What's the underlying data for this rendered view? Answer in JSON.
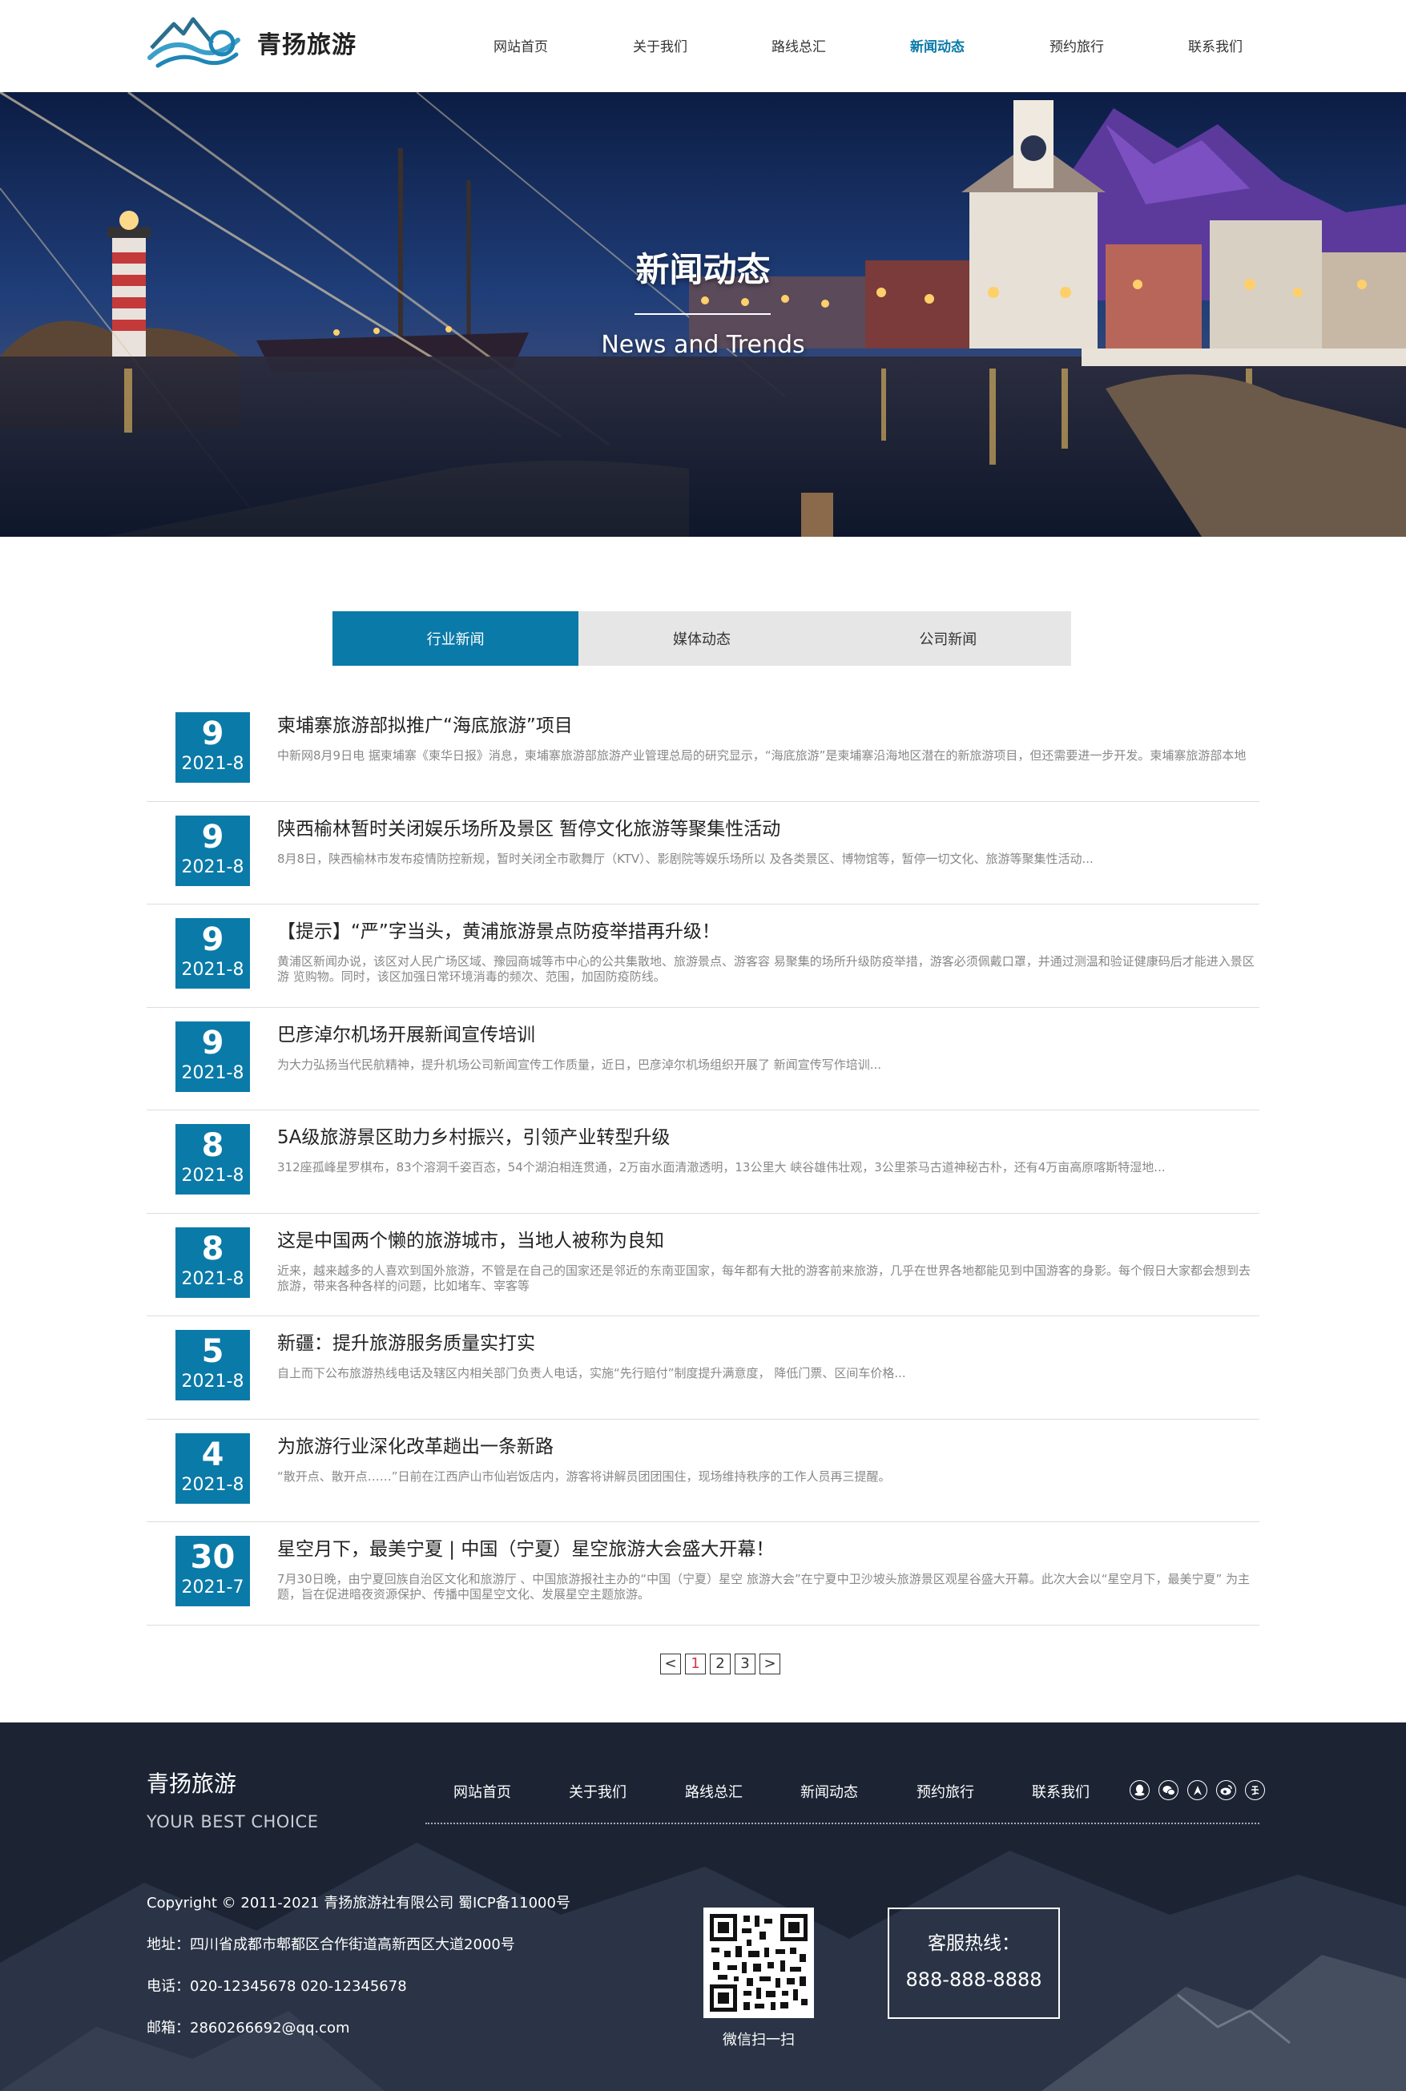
{
  "brand": {
    "name": "青扬旅游"
  },
  "nav": {
    "items": [
      "网站首页",
      "关于我们",
      "路线总汇",
      "新闻动态",
      "预约旅行",
      "联系我们"
    ],
    "active_index": 3
  },
  "banner": {
    "title": "新闻动态",
    "subtitle": "News and Trends"
  },
  "tabs": {
    "items": [
      "行业新闻",
      "媒体动态",
      "公司新闻"
    ],
    "active_index": 0
  },
  "news": [
    {
      "day": "9",
      "ym": "2021-8",
      "title": "柬埔寨旅游部拟推广“海底旅游”项目",
      "desc": "中新网8月9日电 据柬埔寨《柬华日报》消息，柬埔寨旅游部旅游产业管理总局的研究显示，“海底旅游”是柬埔寨沿海地区潜在的新旅游项目，但还需要进一步开发。柬埔寨旅游部本地"
    },
    {
      "day": "9",
      "ym": "2021-8",
      "title": "陕西榆林暂时关闭娱乐场所及景区 暂停文化旅游等聚集性活动",
      "desc": "8月8日，陕西榆林市发布疫情防控新规，暂时关闭全市歌舞厅（KTV）、影剧院等娱乐场所以 及各类景区、博物馆等，暂停一切文化、旅游等聚集性活动..."
    },
    {
      "day": "9",
      "ym": "2021-8",
      "title": "【提示】“严”字当头，黄浦旅游景点防疫举措再升级！",
      "desc": "黄浦区新闻办说，该区对人民广场区域、豫园商城等市中心的公共集散地、旅游景点、游客容 易聚集的场所升级防疫举措，游客必须佩戴口罩，并通过测温和验证健康码后才能进入景区游 览购物。同时，该区加强日常环境消毒的频次、范围，加固防疫防线。"
    },
    {
      "day": "9",
      "ym": "2021-8",
      "title": "巴彦淖尔机场开展新闻宣传培训",
      "desc": "为大力弘扬当代民航精神，提升机场公司新闻宣传工作质量，近日，巴彦淖尔机场组织开展了 新闻宣传写作培训..."
    },
    {
      "day": "8",
      "ym": "2021-8",
      "title": "5A级旅游景区助力乡村振兴，引领产业转型升级",
      "desc": "312座孤峰星罗棋布，83个溶洞千姿百态，54个湖泊相连贯通，2万亩水面清澈透明，13公里大 峡谷雄伟壮观，3公里茶马古道神秘古朴，还有4万亩高原喀斯特湿地..."
    },
    {
      "day": "8",
      "ym": "2021-8",
      "title": "这是中国两个懒的旅游城市，当地人被称为良知",
      "desc": "近来，越来越多的人喜欢到国外旅游，不管是在自己的国家还是邻近的东南亚国家，每年都有大批的游客前来旅游，几乎在世界各地都能见到中国游客的身影。每个假日大家都会想到去旅游，带来各种各样的问题，比如堵车、宰客等"
    },
    {
      "day": "5",
      "ym": "2021-8",
      "title": "新疆：提升旅游服务质量实打实",
      "desc": "自上而下公布旅游热线电话及辖区内相关部门负责人电话，实施“先行赔付”制度提升满意度， 降低门票、区间车价格..."
    },
    {
      "day": "4",
      "ym": "2021-8",
      "title": "为旅游行业深化改革趟出一条新路",
      "desc": "“散开点、散开点……”日前在江西庐山市仙岩饭店内，游客将讲解员团团围住，现场维持秩序的工作人员再三提醒。"
    },
    {
      "day": "30",
      "ym": "2021-7",
      "title": "星空月下，最美宁夏 | 中国（宁夏）星空旅游大会盛大开幕！",
      "desc": "7月30日晚，由宁夏回族自治区文化和旅游厅 、中国旅游报社主办的“中国（宁夏）星空 旅游大会”在宁夏中卫沙坡头旅游景区观星谷盛大开幕。此次大会以“星空月下，最美宁夏” 为主题，旨在促进暗夜资源保护、传播中国星空文化、发展星空主题旅游。"
    }
  ],
  "pagination": {
    "prev": "<",
    "pages": [
      "1",
      "2",
      "3"
    ],
    "current": "1",
    "next": ">"
  },
  "footer": {
    "brand": "青扬旅游",
    "slogan": "YOUR BEST CHOICE",
    "nav": [
      "网站首页",
      "关于我们",
      "路线总汇",
      "新闻动态",
      "预约旅行",
      "联系我们"
    ],
    "social_icons": [
      "qq-icon",
      "wechat-icon",
      "douyin-icon",
      "weibo-icon",
      "alipay-icon"
    ],
    "copyright": "Copyright © 2011-2021 青扬旅游社有限公司 蜀ICP备11000号",
    "address": "地址：四川省成都市郫都区合作街道高新西区大道2000号",
    "phone": "电话：020-12345678 020-12345678",
    "email": "邮箱：2860266692@qq.com",
    "qr_caption": "微信扫一扫",
    "hotline_label": "客服热线：",
    "hotline_number": "888-888-8888"
  },
  "colors": {
    "accent": "#0a7aa8",
    "footer_bg": "#1d2738",
    "tab_bg": "#e6e6e6",
    "pager_active": "#d2374a"
  }
}
